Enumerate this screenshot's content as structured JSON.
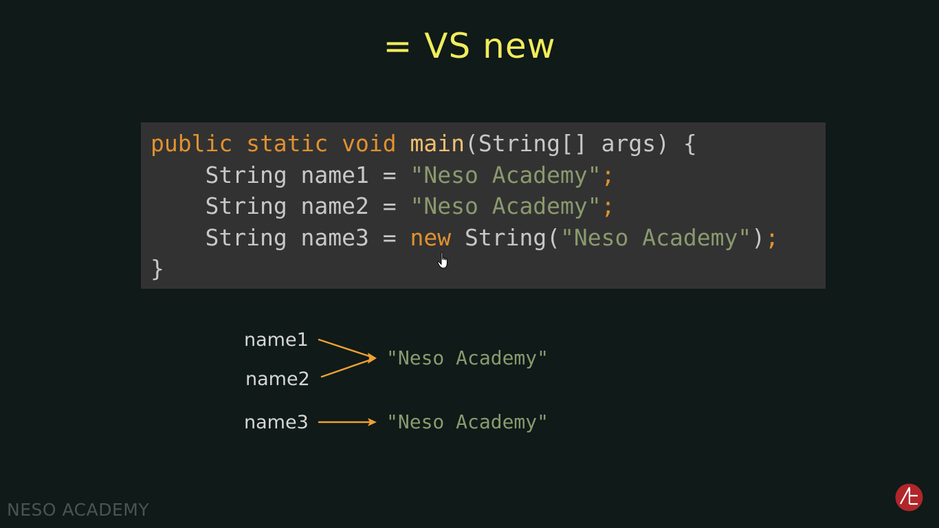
{
  "slide": {
    "title": "= VS new"
  },
  "code": {
    "line1": {
      "kw": "public static void ",
      "fn": "main",
      "rest": "(String[] args) {"
    },
    "line2": {
      "indent": "    ",
      "decl": "String name1 = ",
      "str": "\"Neso Academy\"",
      "semi": ";"
    },
    "line3": {
      "indent": "    ",
      "decl": "String name2 = ",
      "str": "\"Neso Academy\"",
      "semi": ";"
    },
    "line4": {
      "indent": "    ",
      "decl": "String name3 = ",
      "kw": "new",
      "rest1": " String(",
      "str": "\"Neso Academy\"",
      "rest2": ")",
      "semi": ";"
    },
    "line5": {
      "rest": "}"
    }
  },
  "diagram": {
    "name1": "name1",
    "name2": "name2",
    "name3": "name3",
    "value_shared": "\"Neso Academy\"",
    "value_new": "\"Neso Academy\""
  },
  "watermark": "NESO ACADEMY",
  "colors": {
    "background": "#0f1a19",
    "title": "#f2ec5a",
    "code_bg": "#333232",
    "keyword": "#e0922f",
    "string": "#8a9a6e",
    "arrow": "#f0a030"
  },
  "icons": {
    "logo": "neso-academy-logo-icon",
    "cursor": "hand-pointer-icon"
  }
}
